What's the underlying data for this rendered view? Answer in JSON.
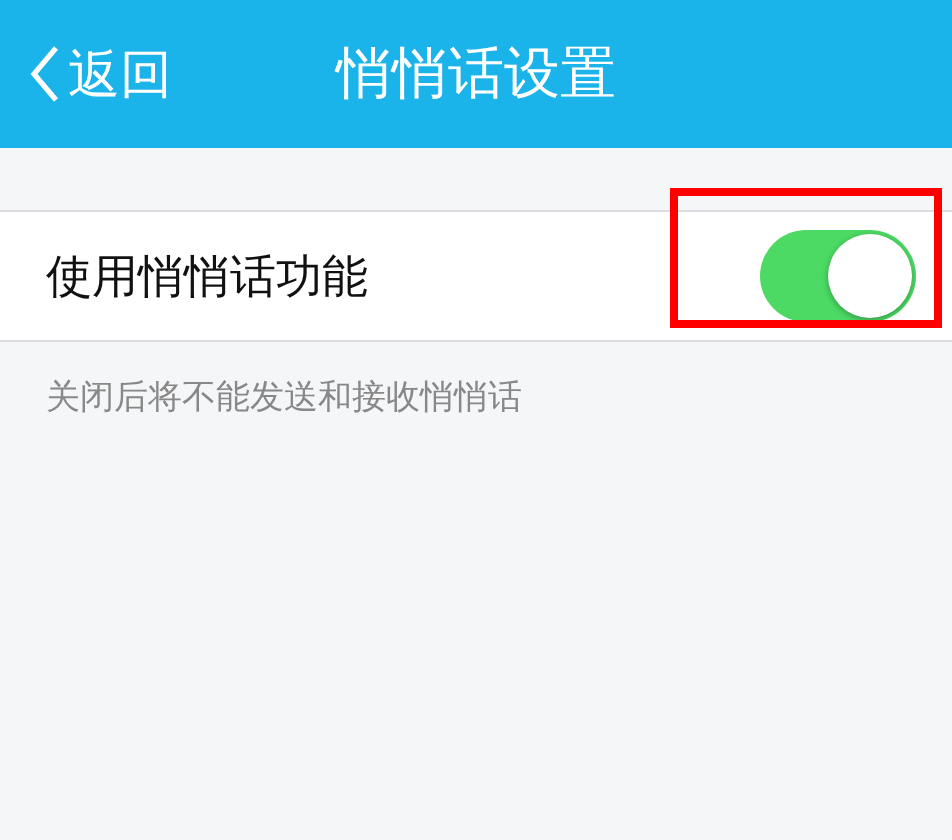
{
  "header": {
    "back": {
      "label": "返回"
    },
    "title": "悄悄话设置"
  },
  "settings": [
    {
      "label": "使用悄悄话功能",
      "kind": "toggle",
      "on": true,
      "highlighted": true
    }
  ],
  "hint": "关闭后将不能发送和接收悄悄话"
}
